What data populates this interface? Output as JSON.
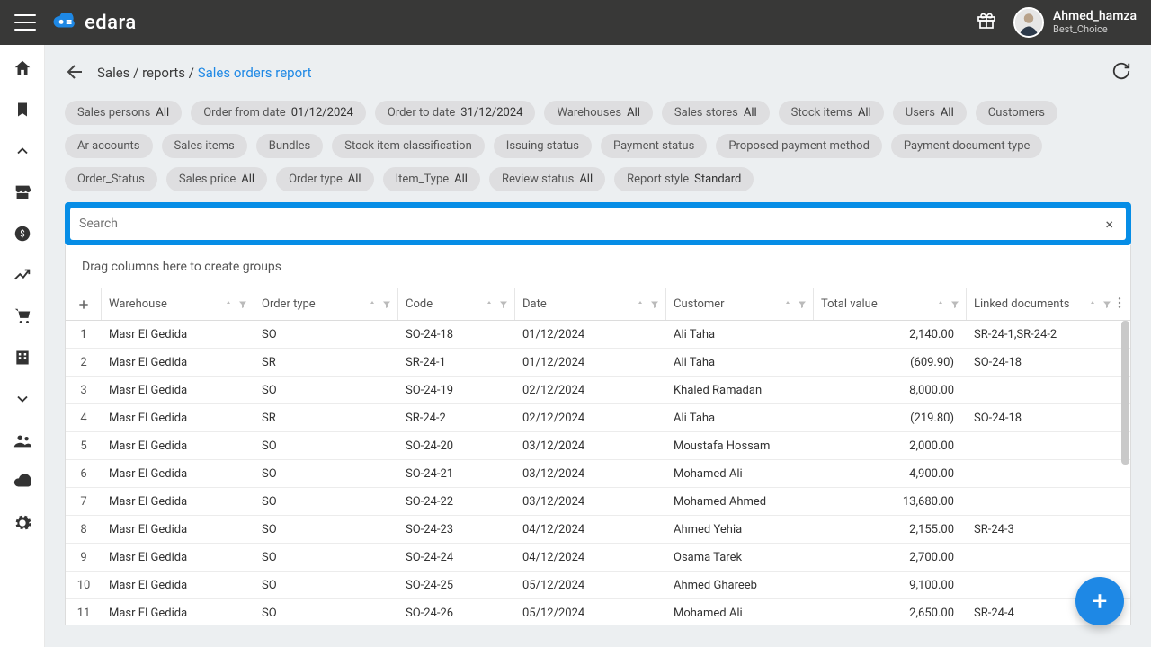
{
  "brand_name": "edara",
  "user": {
    "name": "Ahmed_hamza",
    "sub": "Best_Choice"
  },
  "breadcrumb": {
    "p1": "Sales",
    "p2": "reports",
    "active": "Sales orders report"
  },
  "search": {
    "placeholder": "Search"
  },
  "group_hint": "Drag columns here to create groups",
  "filters": [
    {
      "label": "Sales persons",
      "value": "All"
    },
    {
      "label": "Order from date",
      "value": "01/12/2024"
    },
    {
      "label": "Order to date",
      "value": "31/12/2024"
    },
    {
      "label": "Warehouses",
      "value": "All"
    },
    {
      "label": "Sales stores",
      "value": "All"
    },
    {
      "label": "Stock items",
      "value": "All"
    },
    {
      "label": "Users",
      "value": "All"
    },
    {
      "label": "Customers",
      "value": ""
    },
    {
      "label": "Ar accounts",
      "value": ""
    },
    {
      "label": "Sales items",
      "value": ""
    },
    {
      "label": "Bundles",
      "value": ""
    },
    {
      "label": "Stock item classification",
      "value": ""
    },
    {
      "label": "Issuing status",
      "value": ""
    },
    {
      "label": "Payment status",
      "value": ""
    },
    {
      "label": "Proposed payment method",
      "value": ""
    },
    {
      "label": "Payment document type",
      "value": ""
    },
    {
      "label": "Order_Status",
      "value": ""
    },
    {
      "label": "Sales price",
      "value": "All"
    },
    {
      "label": "Order type",
      "value": "All"
    },
    {
      "label": "Item_Type",
      "value": "All"
    },
    {
      "label": "Review status",
      "value": "All"
    },
    {
      "label": "Report style",
      "value": "Standard"
    }
  ],
  "columns": {
    "warehouse": "Warehouse",
    "order_type": "Order type",
    "code": "Code",
    "date": "Date",
    "customer": "Customer",
    "total": "Total value",
    "linked": "Linked documents"
  },
  "rows": [
    {
      "n": "1",
      "wh": "Masr El Gedida",
      "ot": "SO",
      "code": "SO-24-18",
      "date": "01/12/2024",
      "cust": "Ali Taha",
      "total": "2,140.00",
      "linked": "SR-24-1,SR-24-2"
    },
    {
      "n": "2",
      "wh": "Masr El Gedida",
      "ot": "SR",
      "code": "SR-24-1",
      "date": "01/12/2024",
      "cust": "Ali Taha",
      "total": "(609.90)",
      "linked": "SO-24-18"
    },
    {
      "n": "3",
      "wh": "Masr El Gedida",
      "ot": "SO",
      "code": "SO-24-19",
      "date": "02/12/2024",
      "cust": "Khaled Ramadan",
      "total": "8,000.00",
      "linked": ""
    },
    {
      "n": "4",
      "wh": "Masr El Gedida",
      "ot": "SR",
      "code": "SR-24-2",
      "date": "02/12/2024",
      "cust": "Ali Taha",
      "total": "(219.80)",
      "linked": "SO-24-18"
    },
    {
      "n": "5",
      "wh": "Masr El Gedida",
      "ot": "SO",
      "code": "SO-24-20",
      "date": "03/12/2024",
      "cust": "Moustafa Hossam",
      "total": "2,000.00",
      "linked": ""
    },
    {
      "n": "6",
      "wh": "Masr El Gedida",
      "ot": "SO",
      "code": "SO-24-21",
      "date": "03/12/2024",
      "cust": "Mohamed Ali",
      "total": "4,900.00",
      "linked": ""
    },
    {
      "n": "7",
      "wh": "Masr El Gedida",
      "ot": "SO",
      "code": "SO-24-22",
      "date": "03/12/2024",
      "cust": "Mohamed Ahmed",
      "total": "13,680.00",
      "linked": ""
    },
    {
      "n": "8",
      "wh": "Masr El Gedida",
      "ot": "SO",
      "code": "SO-24-23",
      "date": "04/12/2024",
      "cust": "Ahmed Yehia",
      "total": "2,155.00",
      "linked": "SR-24-3"
    },
    {
      "n": "9",
      "wh": "Masr El Gedida",
      "ot": "SO",
      "code": "SO-24-24",
      "date": "04/12/2024",
      "cust": "Osama Tarek",
      "total": "2,700.00",
      "linked": ""
    },
    {
      "n": "10",
      "wh": "Masr El Gedida",
      "ot": "SO",
      "code": "SO-24-25",
      "date": "05/12/2024",
      "cust": "Ahmed Ghareeb",
      "total": "9,100.00",
      "linked": ""
    },
    {
      "n": "11",
      "wh": "Masr El Gedida",
      "ot": "SO",
      "code": "SO-24-26",
      "date": "05/12/2024",
      "cust": "Mohamed Ali",
      "total": "2,650.00",
      "linked": "SR-24-4"
    }
  ],
  "fab": "+"
}
